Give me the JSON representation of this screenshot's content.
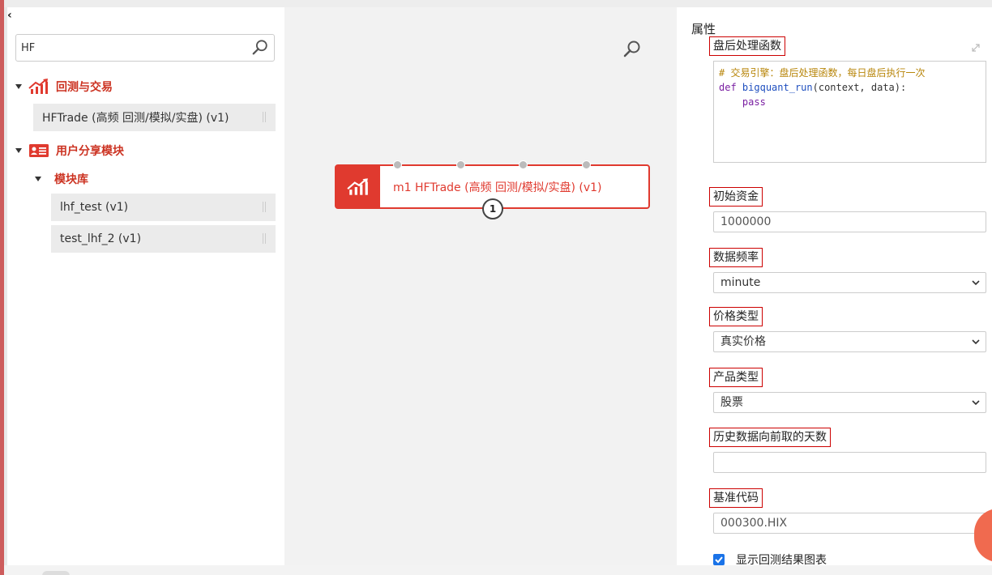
{
  "left_panel": {
    "collapse_glyph": "‹",
    "search": {
      "value": "HF",
      "placeholder": ""
    },
    "groups": [
      {
        "label": "回测与交易",
        "icon": "chart-up-icon",
        "items": [
          {
            "label": "HFTrade (高频 回测/模拟/实盘) (v1)"
          }
        ]
      },
      {
        "label": "用户分享模块",
        "icon": "id-card-icon",
        "subgroups": [
          {
            "label": "模块库",
            "items": [
              {
                "label": "lhf_test (v1)"
              },
              {
                "label": "test_lhf_2 (v1)"
              }
            ]
          }
        ]
      }
    ]
  },
  "canvas": {
    "node": {
      "label": "m1 HFTrade (高频 回测/模拟/实盘) (v1)",
      "icon": "chart-up-icon",
      "output_port": "1",
      "input_port_count": 4
    }
  },
  "properties": {
    "title": "属性",
    "code_label": "盘后处理函数",
    "code": {
      "comment": "# 交易引擎：盘后处理函数，每日盘后执行一次",
      "def_kw": "def",
      "fn_name": "bigquant_run",
      "args": "(context, data):",
      "pass_kw": "pass"
    },
    "fields": [
      {
        "label": "初始资金",
        "value": "1000000",
        "type": "input"
      },
      {
        "label": "数据频率",
        "value": "minute",
        "type": "select"
      },
      {
        "label": "价格类型",
        "value": "真实价格",
        "type": "select"
      },
      {
        "label": "产品类型",
        "value": "股票",
        "type": "select"
      },
      {
        "label": "历史数据向前取的天数",
        "value": "",
        "type": "input"
      },
      {
        "label": "基准代码",
        "value": "000300.HIX",
        "type": "input"
      }
    ],
    "checkbox": {
      "label": "显示回测结果图表",
      "checked": true
    }
  },
  "colors": {
    "accent": "#e03a2f",
    "label_border": "#cc0000",
    "checkbox": "#1a73e8"
  }
}
